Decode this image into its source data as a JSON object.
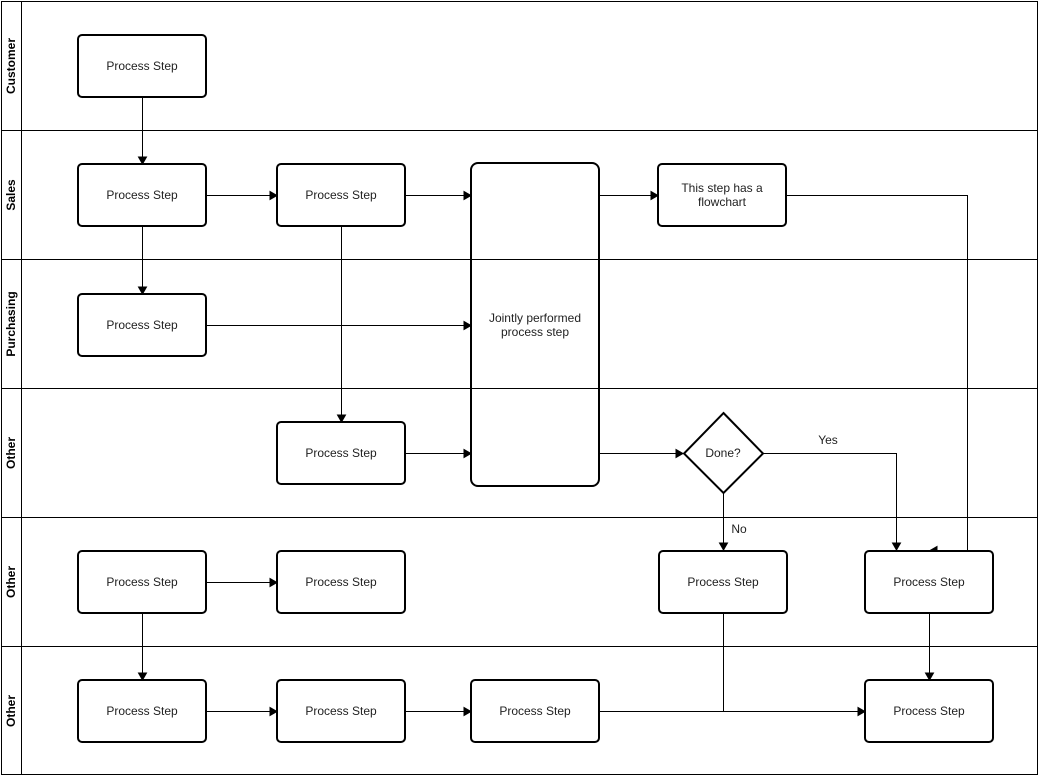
{
  "diagram": {
    "type": "swimlane-flowchart",
    "lanes": [
      {
        "id": "customer",
        "label": "Customer"
      },
      {
        "id": "sales",
        "label": "Sales"
      },
      {
        "id": "purchasing",
        "label": "Purchasing"
      },
      {
        "id": "other1",
        "label": "Other"
      },
      {
        "id": "other2",
        "label": "Other"
      },
      {
        "id": "other3",
        "label": "Other"
      }
    ],
    "nodes": [
      {
        "id": "n1",
        "lane": "customer",
        "label": "Process Step",
        "shape": "process"
      },
      {
        "id": "n2",
        "lane": "sales",
        "label": "Process Step",
        "shape": "process"
      },
      {
        "id": "n3",
        "lane": "sales",
        "label": "Process Step",
        "shape": "process"
      },
      {
        "id": "n4",
        "lane": "sales",
        "label": "This step has a flowchart",
        "lines": [
          "This step has a",
          "flowchart"
        ],
        "shape": "process"
      },
      {
        "id": "n5",
        "lane": "purchasing",
        "label": "Process Step",
        "shape": "process"
      },
      {
        "id": "joint",
        "lane": "sales-purchasing-other",
        "label": "Jointly performed process step",
        "lines": [
          "Jointly performed",
          "process step"
        ],
        "shape": "process-multilane"
      },
      {
        "id": "n6",
        "lane": "other1",
        "label": "Process Step",
        "shape": "process"
      },
      {
        "id": "done",
        "lane": "other1",
        "label": "Done?",
        "shape": "decision"
      },
      {
        "id": "n7",
        "lane": "other2",
        "label": "Process Step",
        "shape": "process"
      },
      {
        "id": "n8",
        "lane": "other2",
        "label": "Process Step",
        "shape": "process"
      },
      {
        "id": "n9",
        "lane": "other2",
        "label": "Process Step",
        "shape": "process"
      },
      {
        "id": "n10",
        "lane": "other2",
        "label": "Process Step",
        "shape": "process"
      },
      {
        "id": "n11",
        "lane": "other3",
        "label": "Process Step",
        "shape": "process"
      },
      {
        "id": "n12",
        "lane": "other3",
        "label": "Process Step",
        "shape": "process"
      },
      {
        "id": "n13",
        "lane": "other3",
        "label": "Process Step",
        "shape": "process"
      },
      {
        "id": "n14",
        "lane": "other3",
        "label": "Process Step",
        "shape": "process"
      }
    ],
    "edges": [
      {
        "from": "n1",
        "to": "n2",
        "label": ""
      },
      {
        "from": "n2",
        "to": "n3",
        "label": ""
      },
      {
        "from": "n2",
        "to": "n5",
        "label": ""
      },
      {
        "from": "n3",
        "to": "joint",
        "label": ""
      },
      {
        "from": "n3",
        "to": "n6",
        "label": ""
      },
      {
        "from": "n5",
        "to": "joint",
        "label": ""
      },
      {
        "from": "n6",
        "to": "joint",
        "label": ""
      },
      {
        "from": "joint",
        "to": "n4",
        "label": ""
      },
      {
        "from": "joint",
        "to": "done",
        "label": ""
      },
      {
        "from": "done",
        "to": "n10",
        "label": "Yes"
      },
      {
        "from": "done",
        "to": "n9",
        "label": "No"
      },
      {
        "from": "n4",
        "to": "n10",
        "label": ""
      },
      {
        "from": "n7",
        "to": "n8",
        "label": ""
      },
      {
        "from": "n7",
        "to": "n11",
        "label": ""
      },
      {
        "from": "n11",
        "to": "n12",
        "label": ""
      },
      {
        "from": "n12",
        "to": "n13",
        "label": ""
      },
      {
        "from": "n13",
        "to": "n14",
        "label": ""
      },
      {
        "from": "n9",
        "to": "n14",
        "label": ""
      },
      {
        "from": "n10",
        "to": "n14",
        "label": ""
      }
    ]
  }
}
